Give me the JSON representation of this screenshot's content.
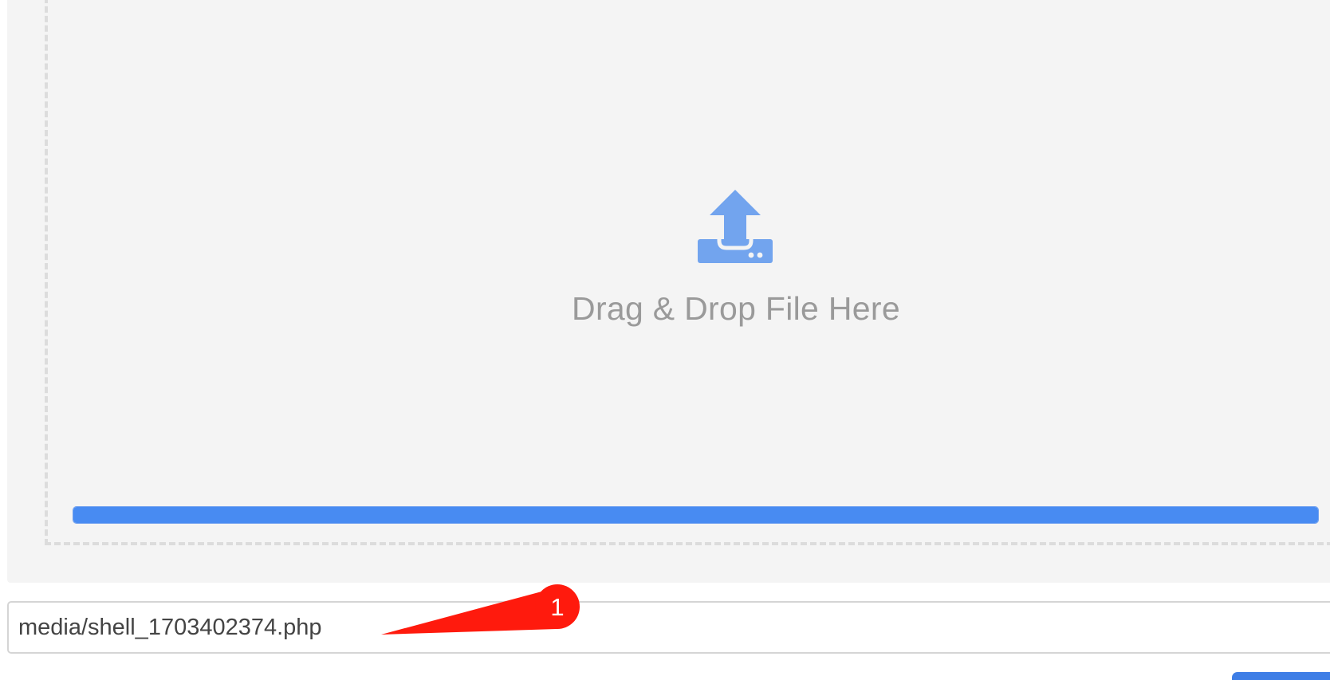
{
  "dropzone": {
    "label": "Drag & Drop File Here",
    "icon": "upload-icon",
    "progress_percent": 100
  },
  "path_input": {
    "value": "media/shell_1703402374.php"
  },
  "annotation": {
    "number": "1",
    "color": "#ff1a0d"
  },
  "colors": {
    "accent": "#488bf2",
    "icon": "#72a4ee"
  }
}
